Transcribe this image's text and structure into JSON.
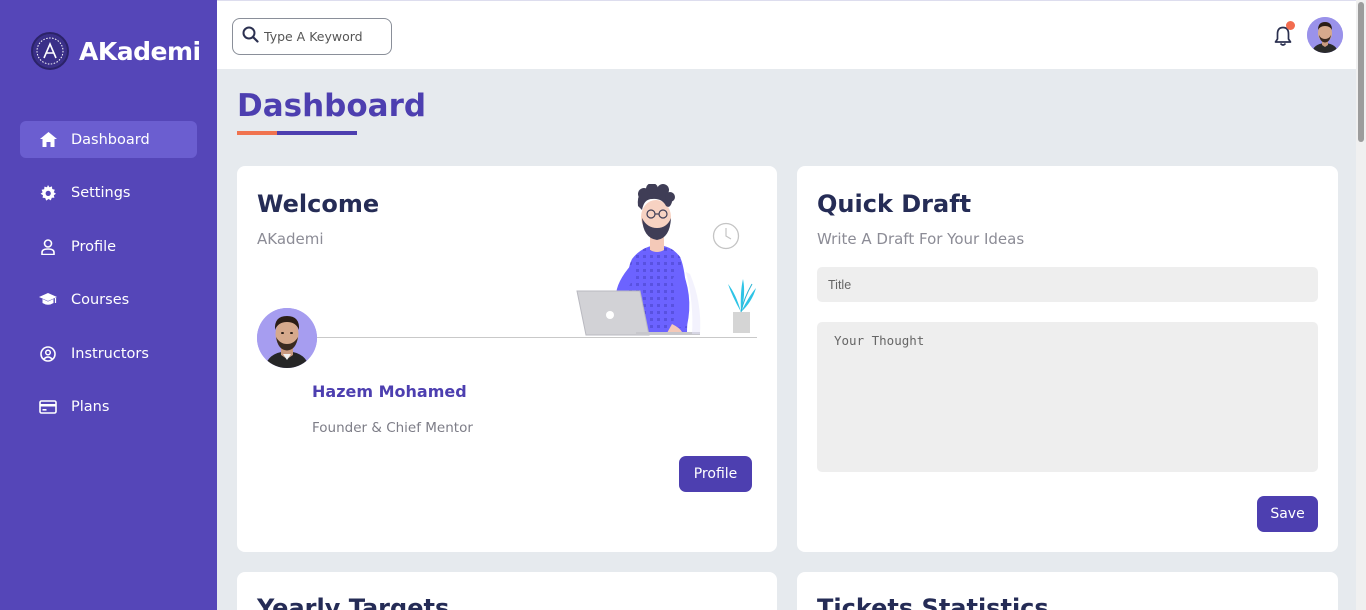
{
  "sidebar": {
    "brand": "AKademi",
    "items": [
      {
        "label": "Dashboard",
        "icon": "home-icon",
        "active": true
      },
      {
        "label": "Settings",
        "icon": "gear-icon"
      },
      {
        "label": "Profile",
        "icon": "user-icon"
      },
      {
        "label": "Courses",
        "icon": "graduation-cap-icon"
      },
      {
        "label": "Instructors",
        "icon": "user-circle-icon"
      },
      {
        "label": "Plans",
        "icon": "credit-card-icon"
      }
    ]
  },
  "header": {
    "search_placeholder": "Type A Keyword",
    "notification_icon": "bell-icon",
    "has_notification": true
  },
  "page": {
    "title": "Dashboard"
  },
  "welcome": {
    "title": "Welcome",
    "subtitle": "AKademi",
    "name": "Hazem Mohamed",
    "role": "Founder & Chief Mentor",
    "button": "Profile"
  },
  "draft": {
    "title": "Quick Draft",
    "subtitle": "Write A Draft For Your Ideas",
    "title_placeholder": "Title",
    "thought_placeholder": "Your Thought",
    "button": "Save"
  },
  "bottom_cards": {
    "left_title": "Yearly Targets",
    "right_title": "Tickets Statistics"
  },
  "colors": {
    "sidebar": "#5546b8",
    "accent": "#4d3fb0",
    "orange": "#f0734f",
    "background": "#e6eaee"
  }
}
